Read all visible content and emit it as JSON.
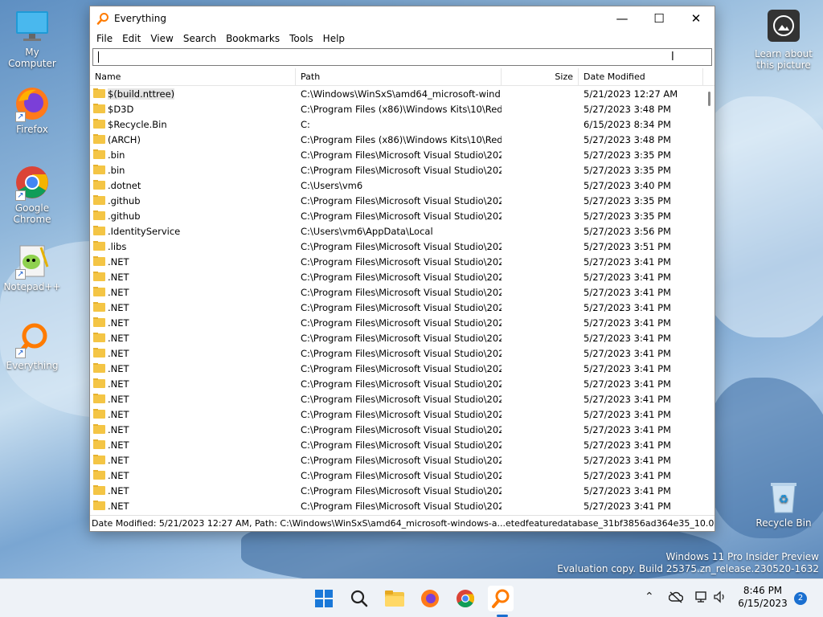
{
  "desktop": {
    "icons": [
      {
        "label": "My Computer"
      },
      {
        "label": "Firefox"
      },
      {
        "label": "Google Chrome"
      },
      {
        "label": "Notepad++"
      },
      {
        "label": "Everything"
      }
    ],
    "learn_label": "Learn about this picture",
    "recycle_label": "Recycle Bin",
    "watermark_line1": "Windows 11 Pro Insider Preview",
    "watermark_line2": "Evaluation copy. Build 25375.zn_release.230520-1632"
  },
  "window": {
    "title": "Everything",
    "menu": [
      "File",
      "Edit",
      "View",
      "Search",
      "Bookmarks",
      "Tools",
      "Help"
    ],
    "search_value": "",
    "columns": {
      "name": "Name",
      "path": "Path",
      "size": "Size",
      "date": "Date Modified"
    },
    "rows": [
      {
        "name": "$(build.nttree)",
        "path": "C:\\Windows\\WinSxS\\amd64_microsoft-wind...",
        "size": "",
        "date": "5/21/2023 12:27 AM"
      },
      {
        "name": "$D3D",
        "path": "C:\\Program Files (x86)\\Windows Kits\\10\\Redist",
        "size": "",
        "date": "5/27/2023 3:48 PM"
      },
      {
        "name": "$Recycle.Bin",
        "path": "C:",
        "size": "",
        "date": "6/15/2023 8:34 PM"
      },
      {
        "name": "(ARCH)",
        "path": "C:\\Program Files (x86)\\Windows Kits\\10\\Redi...",
        "size": "",
        "date": "5/27/2023 3:48 PM"
      },
      {
        "name": ".bin",
        "path": "C:\\Program Files\\Microsoft Visual Studio\\202...",
        "size": "",
        "date": "5/27/2023 3:35 PM"
      },
      {
        "name": ".bin",
        "path": "C:\\Program Files\\Microsoft Visual Studio\\202...",
        "size": "",
        "date": "5/27/2023 3:35 PM"
      },
      {
        "name": ".dotnet",
        "path": "C:\\Users\\vm6",
        "size": "",
        "date": "5/27/2023 3:40 PM"
      },
      {
        "name": ".github",
        "path": "C:\\Program Files\\Microsoft Visual Studio\\202...",
        "size": "",
        "date": "5/27/2023 3:35 PM"
      },
      {
        "name": ".github",
        "path": "C:\\Program Files\\Microsoft Visual Studio\\202...",
        "size": "",
        "date": "5/27/2023 3:35 PM"
      },
      {
        "name": ".IdentityService",
        "path": "C:\\Users\\vm6\\AppData\\Local",
        "size": "",
        "date": "5/27/2023 3:56 PM"
      },
      {
        "name": ".libs",
        "path": "C:\\Program Files\\Microsoft Visual Studio\\202...",
        "size": "",
        "date": "5/27/2023 3:51 PM"
      },
      {
        "name": ".NET",
        "path": "C:\\Program Files\\Microsoft Visual Studio\\202...",
        "size": "",
        "date": "5/27/2023 3:41 PM"
      },
      {
        "name": ".NET",
        "path": "C:\\Program Files\\Microsoft Visual Studio\\202...",
        "size": "",
        "date": "5/27/2023 3:41 PM"
      },
      {
        "name": ".NET",
        "path": "C:\\Program Files\\Microsoft Visual Studio\\202...",
        "size": "",
        "date": "5/27/2023 3:41 PM"
      },
      {
        "name": ".NET",
        "path": "C:\\Program Files\\Microsoft Visual Studio\\202...",
        "size": "",
        "date": "5/27/2023 3:41 PM"
      },
      {
        "name": ".NET",
        "path": "C:\\Program Files\\Microsoft Visual Studio\\202...",
        "size": "",
        "date": "5/27/2023 3:41 PM"
      },
      {
        "name": ".NET",
        "path": "C:\\Program Files\\Microsoft Visual Studio\\202...",
        "size": "",
        "date": "5/27/2023 3:41 PM"
      },
      {
        "name": ".NET",
        "path": "C:\\Program Files\\Microsoft Visual Studio\\202...",
        "size": "",
        "date": "5/27/2023 3:41 PM"
      },
      {
        "name": ".NET",
        "path": "C:\\Program Files\\Microsoft Visual Studio\\202...",
        "size": "",
        "date": "5/27/2023 3:41 PM"
      },
      {
        "name": ".NET",
        "path": "C:\\Program Files\\Microsoft Visual Studio\\202...",
        "size": "",
        "date": "5/27/2023 3:41 PM"
      },
      {
        "name": ".NET",
        "path": "C:\\Program Files\\Microsoft Visual Studio\\202...",
        "size": "",
        "date": "5/27/2023 3:41 PM"
      },
      {
        "name": ".NET",
        "path": "C:\\Program Files\\Microsoft Visual Studio\\202...",
        "size": "",
        "date": "5/27/2023 3:41 PM"
      },
      {
        "name": ".NET",
        "path": "C:\\Program Files\\Microsoft Visual Studio\\202...",
        "size": "",
        "date": "5/27/2023 3:41 PM"
      },
      {
        "name": ".NET",
        "path": "C:\\Program Files\\Microsoft Visual Studio\\202...",
        "size": "",
        "date": "5/27/2023 3:41 PM"
      },
      {
        "name": ".NET",
        "path": "C:\\Program Files\\Microsoft Visual Studio\\202...",
        "size": "",
        "date": "5/27/2023 3:41 PM"
      },
      {
        "name": ".NET",
        "path": "C:\\Program Files\\Microsoft Visual Studio\\202...",
        "size": "",
        "date": "5/27/2023 3:41 PM"
      },
      {
        "name": ".NET",
        "path": "C:\\Program Files\\Microsoft Visual Studio\\202...",
        "size": "",
        "date": "5/27/2023 3:41 PM"
      },
      {
        "name": ".NET",
        "path": "C:\\Program Files\\Microsoft Visual Studio\\202...",
        "size": "",
        "date": "5/27/2023 3:41 PM"
      }
    ],
    "status": "Date Modified: 5/21/2023 12:27 AM, Path: C:\\Windows\\WinSxS\\amd64_microsoft-windows-a...etedfeaturedatabase_31bf3856ad364e35_10.0.25375.1_none"
  },
  "taskbar": {
    "time": "8:46 PM",
    "date": "6/15/2023",
    "notification_count": "2"
  },
  "colors": {
    "accent": "#1a6fd0",
    "folder": "#f4c545",
    "selection": "#e5e5e5"
  },
  "icons": [
    "windows-logo-icon",
    "search-icon",
    "file-explorer-icon",
    "firefox-icon",
    "chrome-icon",
    "everything-icon",
    "chevron-up-icon",
    "cloud-off-icon",
    "network-icon",
    "volume-icon"
  ]
}
